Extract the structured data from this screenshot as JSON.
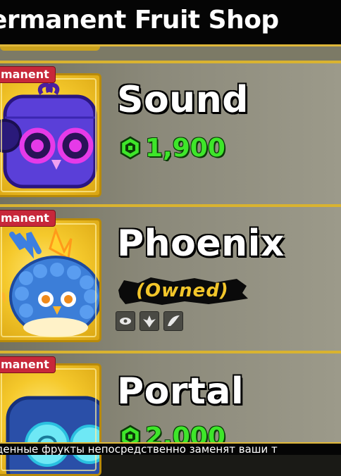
{
  "header": {
    "title": "ermanent Fruit Shop"
  },
  "fruits": [
    {
      "badge": "manent",
      "name": "Sound",
      "price": "1,900",
      "owned": false
    },
    {
      "badge": "manent",
      "name": "Phoenix",
      "owned_label": "(Owned)",
      "owned": true,
      "skill_icons": [
        "eye-skill-icon",
        "phoenix-skill-icon",
        "wing-skill-icon"
      ]
    },
    {
      "badge": "manent",
      "name": "Portal",
      "price": "2,000",
      "owned": false
    }
  ],
  "footer": {
    "text": "денные фрукты непосредственно заменят ваши т"
  },
  "colors": {
    "gold": "#d9b330",
    "robux_green": "#3ee62a",
    "badge_red": "#c7283a",
    "owned_gold": "#f3c62a"
  }
}
